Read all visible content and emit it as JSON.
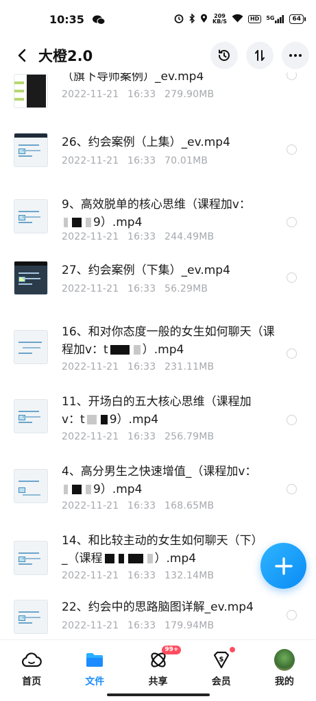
{
  "status_bar": {
    "time": "10:35",
    "speed_value": "209",
    "speed_unit": "KB/S",
    "hd": "HD",
    "network": "5G",
    "battery": "64"
  },
  "header": {
    "title": "大橙2.0"
  },
  "files": [
    {
      "name": "（旗下导师案例）_ev.mp4",
      "date": "2022-11-21",
      "time": "16:33",
      "size": "279.90MB"
    },
    {
      "name": "26、约会案例（上集）_ev.mp4",
      "date": "2022-11-21",
      "time": "16:33",
      "size": "70.01MB"
    },
    {
      "name_a": "9、高效脱单的核心思维（课程加v：",
      "name_b": "9）.mp4",
      "date": "2022-11-21",
      "time": "16:33",
      "size": "244.49MB"
    },
    {
      "name": "27、约会案例（下集）_ev.mp4",
      "date": "2022-11-21",
      "time": "16:33",
      "size": "56.29MB"
    },
    {
      "name_a": "16、和对你态度一般的女生如何聊天（课程加v：t",
      "name_b": "）.mp4",
      "date": "2022-11-21",
      "time": "16:33",
      "size": "231.11MB"
    },
    {
      "name_a": "11、开场白的五大核心思维（课程加v：t",
      "name_b": "9）.mp4",
      "date": "2022-11-21",
      "time": "16:33",
      "size": "256.79MB"
    },
    {
      "name_a": "4、高分男生之快速增值_（课程加v：",
      "name_b": "9）.mp4",
      "date": "2022-11-21",
      "time": "16:33",
      "size": "168.65MB"
    },
    {
      "name_a": "14、和比较主动的女生如何聊天（下）_（课程",
      "name_b": "）.mp4",
      "date": "2022-11-21",
      "time": "16:33",
      "size": "132.14MB"
    },
    {
      "name": "22、约会中的思路脑图详解_ev.mp4",
      "date": "2022-11-21",
      "time": "16:33",
      "size": "179.94MB"
    }
  ],
  "nav": {
    "home": "首页",
    "files": "文件",
    "share": "共享",
    "share_badge": "99+",
    "vip": "会员",
    "mine": "我的"
  },
  "colors": {
    "accent": "#1a8cff",
    "badge": "#ff4d5f",
    "meta_text": "#a5a8ad"
  }
}
